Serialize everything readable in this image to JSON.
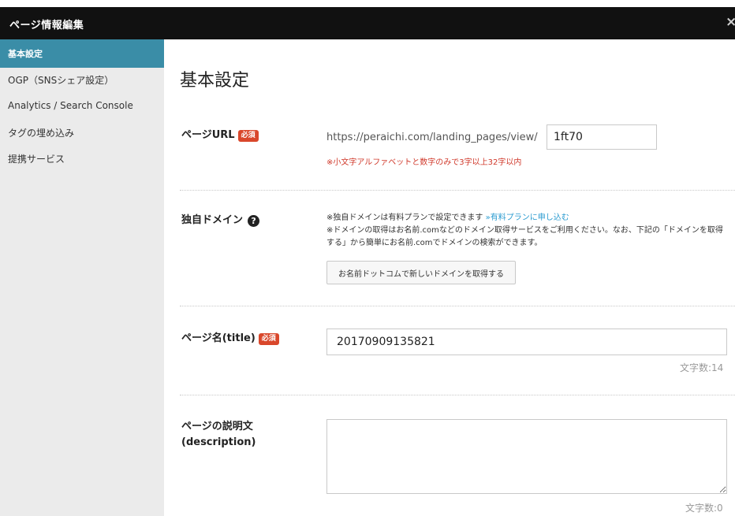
{
  "window": {
    "title": "ページ情報編集",
    "close_glyph": "×"
  },
  "sidebar": {
    "items": [
      {
        "label": "基本設定",
        "active": true
      },
      {
        "label": "OGP（SNSシェア設定）",
        "active": false
      },
      {
        "label": "Analytics / Search Console",
        "active": false
      },
      {
        "label": "タグの埋め込み",
        "active": false
      },
      {
        "label": "提携サービス",
        "active": false
      }
    ]
  },
  "main": {
    "heading": "基本設定",
    "required_badge": "必須",
    "page_url": {
      "label": "ページURL",
      "prefix": "https://peraichi.com/landing_pages/view/",
      "value": "1ft70",
      "note": "※小文字アルファベットと数字のみで3字以上32字以内"
    },
    "domain": {
      "label": "独自ドメイン",
      "help_icon": "question-circle-icon",
      "line1": "※独自ドメインは有料プランで設定できます",
      "link": "»有料プランに申し込む",
      "line2": "※ドメインの取得はお名前.comなどのドメイン取得サービスをご利用ください。なお、下記の「ドメインを取得する」から簡単にお名前.comでドメインの検索ができます。",
      "button": "お名前ドットコムで新しいドメインを取得する"
    },
    "page_title": {
      "label": "ページ名(title)",
      "value": "20170909135821",
      "count": "文字数:14"
    },
    "description": {
      "label_line1": "ページの説明文",
      "label_line2": "(description)",
      "value": "",
      "count": "文字数:0"
    }
  },
  "colors": {
    "titlebar": "#111111",
    "sidebar_bg": "#ebebeb",
    "sidebar_active": "#3a8da7",
    "badge": "#d9472b",
    "error_text": "#d0392b",
    "link": "#2a9bd0"
  }
}
